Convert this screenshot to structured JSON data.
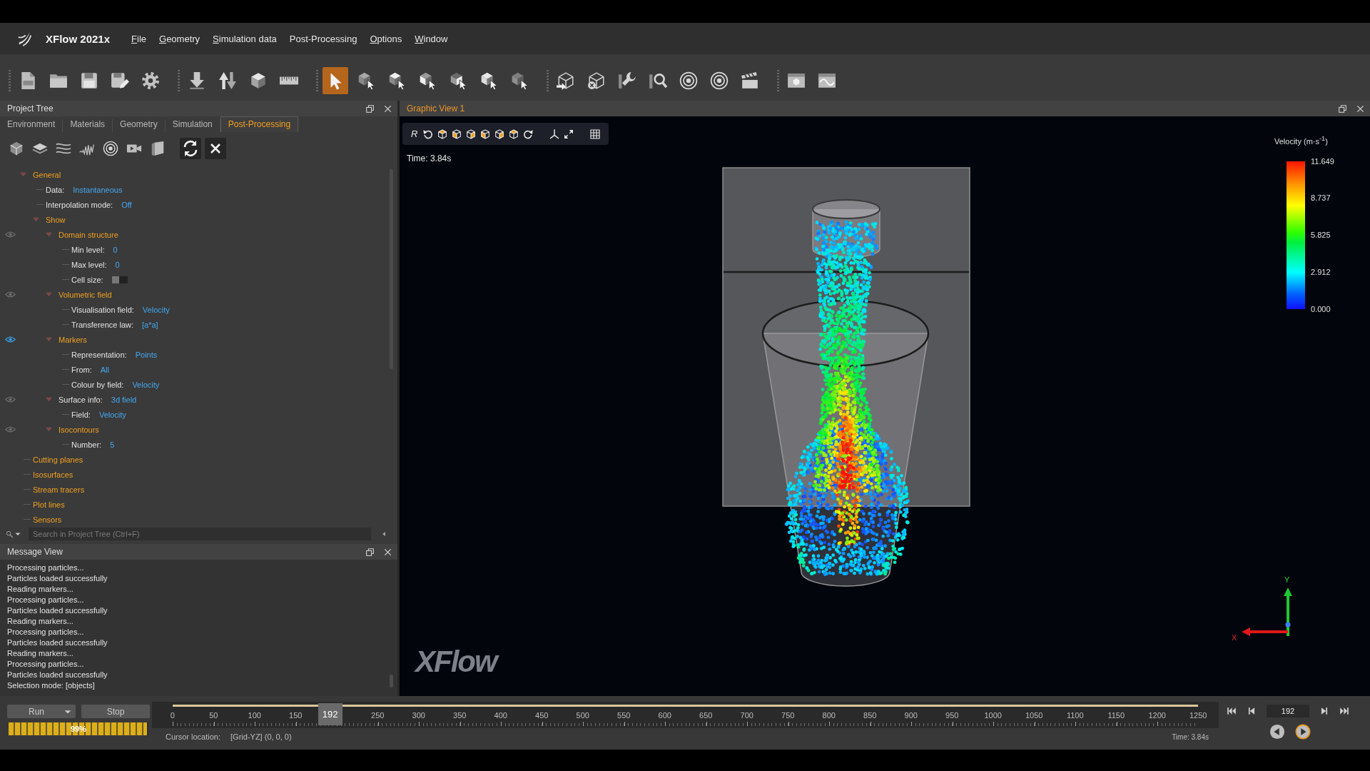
{
  "app": {
    "title": "XFlow 2021x"
  },
  "menu": [
    {
      "label": "File",
      "mnemonic": true
    },
    {
      "label": "Geometry",
      "mnemonic": true
    },
    {
      "label": "Simulation data",
      "mnemonic": true
    },
    {
      "label": "Post-Processing",
      "mnemonic": false
    },
    {
      "label": "Options",
      "mnemonic": true
    },
    {
      "label": "Window",
      "mnemonic": true
    }
  ],
  "toolbar": {
    "selection_modes": [
      {
        "selected": true
      },
      {
        "selected": false
      },
      {
        "selected": false
      },
      {
        "selected": false
      },
      {
        "selected": false
      },
      {
        "selected": false
      },
      {
        "selected": false
      }
    ]
  },
  "project_tree": {
    "title": "Project Tree",
    "tabs": [
      {
        "label": "Environment",
        "selected": false
      },
      {
        "label": "Materials",
        "selected": false
      },
      {
        "label": "Geometry",
        "selected": false
      },
      {
        "label": "Simulation",
        "selected": false
      },
      {
        "label": "Post-Processing",
        "selected": true
      }
    ],
    "nodes": [
      {
        "kind": "group",
        "label": "General",
        "expanded": true,
        "children": [
          {
            "kind": "property",
            "label": "Data:",
            "value": "Instantaneous"
          },
          {
            "kind": "property",
            "label": "Interpolation mode:",
            "value": "Off"
          },
          {
            "kind": "group",
            "label": "Show",
            "expanded": true,
            "children": [
              {
                "kind": "group",
                "label": "Domain structure",
                "visible": false,
                "expanded": true,
                "children": [
                  {
                    "kind": "property",
                    "label": "Min level:",
                    "value": "0"
                  },
                  {
                    "kind": "property",
                    "label": "Max level:",
                    "value": "0"
                  },
                  {
                    "kind": "toggle",
                    "label": "Cell size:",
                    "on": false
                  }
                ]
              },
              {
                "kind": "group",
                "label": "Volumetric field",
                "visible": false,
                "expanded": true,
                "children": [
                  {
                    "kind": "property",
                    "label": "Visualisation field:",
                    "value": "Velocity"
                  },
                  {
                    "kind": "property",
                    "label": "Transference law:",
                    "value": "[a*a]"
                  }
                ]
              },
              {
                "kind": "group",
                "label": "Markers",
                "visible": true,
                "expanded": true,
                "children": [
                  {
                    "kind": "property",
                    "label": "Representation:",
                    "value": "Points"
                  },
                  {
                    "kind": "property",
                    "label": "From:",
                    "value": "All"
                  },
                  {
                    "kind": "property",
                    "label": "Colour by field:",
                    "value": "Velocity"
                  }
                ]
              },
              {
                "kind": "property",
                "label": "Surface info:",
                "value": "3d field",
                "visible": false,
                "expanded": true,
                "children": [
                  {
                    "kind": "property",
                    "label": "Field:",
                    "value": "Velocity"
                  }
                ]
              },
              {
                "kind": "group",
                "label": "Isocontours",
                "visible": false,
                "expanded": true,
                "children": [
                  {
                    "kind": "property",
                    "label": "Number:",
                    "value": "5"
                  }
                ]
              }
            ]
          }
        ]
      },
      {
        "kind": "group",
        "label": "Cutting planes"
      },
      {
        "kind": "group",
        "label": "Isosurfaces"
      },
      {
        "kind": "group",
        "label": "Stream tracers"
      },
      {
        "kind": "group",
        "label": "Plot lines"
      },
      {
        "kind": "group",
        "label": "Sensors"
      }
    ],
    "search": {
      "placeholder": "Search in Project Tree (Ctrl+F)"
    }
  },
  "message_view": {
    "title": "Message View",
    "messages": [
      "Processing particles...",
      "Particles loaded successfully",
      "Reading markers...",
      "Processing particles...",
      "Particles loaded successfully",
      "Reading markers...",
      "Processing particles...",
      "Particles loaded successfully",
      "Reading markers...",
      "Processing particles...",
      "Particles loaded successfully",
      "Selection mode: [objects]"
    ]
  },
  "graphic_view": {
    "title": "Graphic View 1",
    "reset_label": "R",
    "time": "Time: 3.84s",
    "legend": {
      "title": "Velocity (m·s$^{-1}$)",
      "labels": [
        "11.649",
        "8.737",
        "5.825",
        "2.912",
        "0.000"
      ]
    },
    "axes": {
      "y_label": "Y",
      "x_label": "X"
    },
    "logo": "XFlow"
  },
  "run_controls": {
    "run": "Run",
    "stop": "Stop",
    "progress": {
      "level": 0.99,
      "label": "99%"
    }
  },
  "timeline": {
    "ticks": [
      "0",
      "50",
      "100",
      "150",
      "250",
      "300",
      "350",
      "400",
      "450",
      "500",
      "550",
      "600",
      "650",
      "700",
      "750",
      "800",
      "850",
      "900",
      "950",
      "1000",
      "1050",
      "1100",
      "1150",
      "1200",
      "1250"
    ],
    "level": 0.1536,
    "thumb_label": "192",
    "frame": "192",
    "time": "Time: 3.84s"
  },
  "status": {
    "label": "Cursor location:",
    "value": "[Grid-YZ] (0, 0, 0)"
  }
}
